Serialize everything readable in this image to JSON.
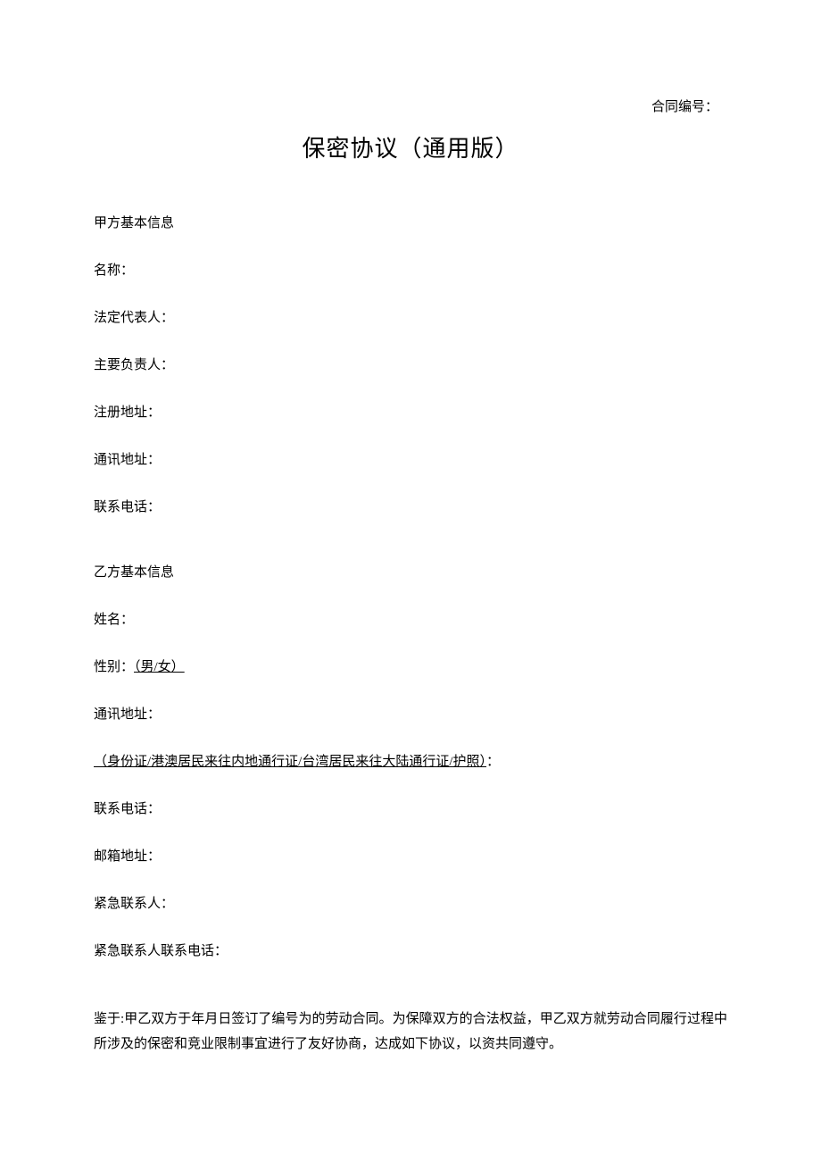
{
  "header": {
    "contract_no_label": "合同编号：",
    "title": "保密协议（通用版）"
  },
  "partyA": {
    "section_label": "甲方基本信息",
    "name_label": "名称：",
    "legal_rep_label": "法定代表人：",
    "principal_label": "主要负责人：",
    "reg_address_label": "注册地址：",
    "mail_address_label": "通讯地址：",
    "phone_label": "联系电话："
  },
  "partyB": {
    "section_label": "乙方基本信息",
    "name_label": "姓名：",
    "gender_label": "性别：",
    "gender_value": "（男/女）",
    "mail_address_label": "通讯地址：",
    "id_label": "（身份证/港澳居民来往内地通行证/台湾居民来往大陆通行证/护照）",
    "id_colon": "：",
    "phone_label": "联系电话：",
    "email_label": "邮箱地址：",
    "emergency_contact_label": "紧急联系人：",
    "emergency_phone_label": "紧急联系人联系电话："
  },
  "recital": {
    "text": "鉴于:甲乙双方于年月日签订了编号为的劳动合同。为保障双方的合法权益，甲乙双方就劳动合同履行过程中所涉及的保密和竞业限制事宜进行了友好协商，达成如下协议，以资共同遵守。"
  }
}
